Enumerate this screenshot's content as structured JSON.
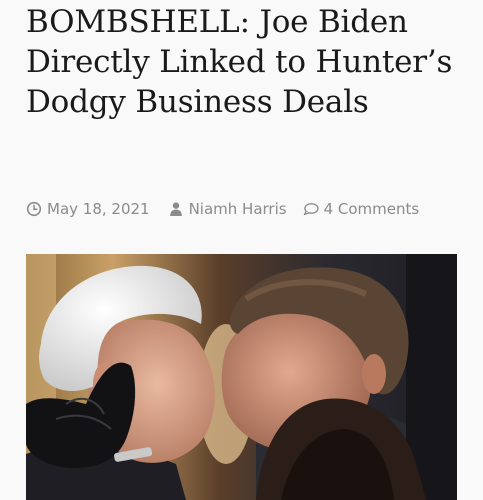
{
  "article": {
    "title": "BOMBSHELL: Joe Biden Directly Linked to Hunter’s Dodgy Business Deals",
    "date": "May 18, 2021",
    "author": "Niamh Harris",
    "comments": "4 Comments"
  },
  "icons": {
    "date": "clock-icon",
    "author": "user-icon",
    "comments": "comment-bubble-icon"
  },
  "colors": {
    "headline": "#1a1a1a",
    "meta": "#8b8b8b",
    "background": "#f9f9f9"
  }
}
